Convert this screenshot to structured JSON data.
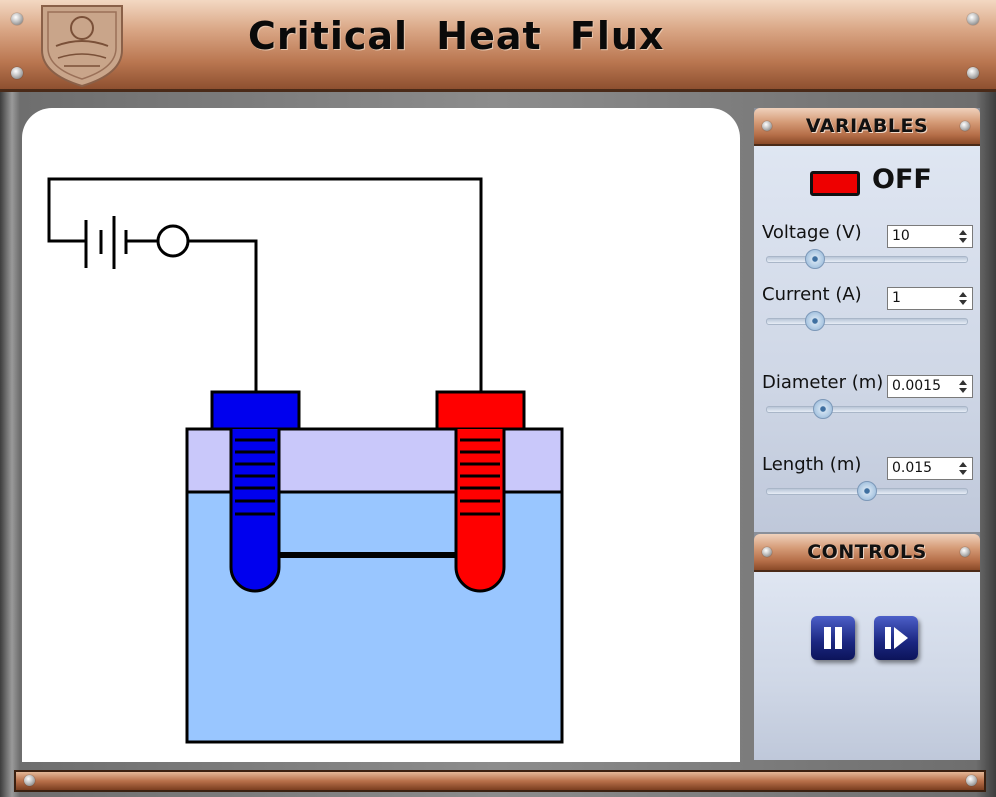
{
  "app": {
    "title": "Critical Heat Flux"
  },
  "variables_panel": {
    "header": "VARIABLES",
    "power_state": "OFF",
    "indicator_color": "#ee0000",
    "fields": [
      {
        "label": "Voltage (V)",
        "value": "10",
        "slider_fraction": 0.24
      },
      {
        "label": "Current (A)",
        "value": "1",
        "slider_fraction": 0.24
      },
      {
        "label": "Diameter (m)",
        "value": "0.0015",
        "slider_fraction": 0.28
      },
      {
        "label": "Length (m)",
        "value": "0.015",
        "slider_fraction": 0.5
      }
    ]
  },
  "controls_panel": {
    "header": "CONTROLS",
    "buttons": [
      {
        "name": "pause",
        "icon": "pause-icon"
      },
      {
        "name": "step",
        "icon": "step-forward-icon"
      }
    ]
  },
  "apparatus": {
    "electrode_left_color": "#0000ee",
    "electrode_right_color": "#ff0000",
    "liquid_color": "#99c6ff",
    "cap_layer_color": "#c9c8fa"
  }
}
